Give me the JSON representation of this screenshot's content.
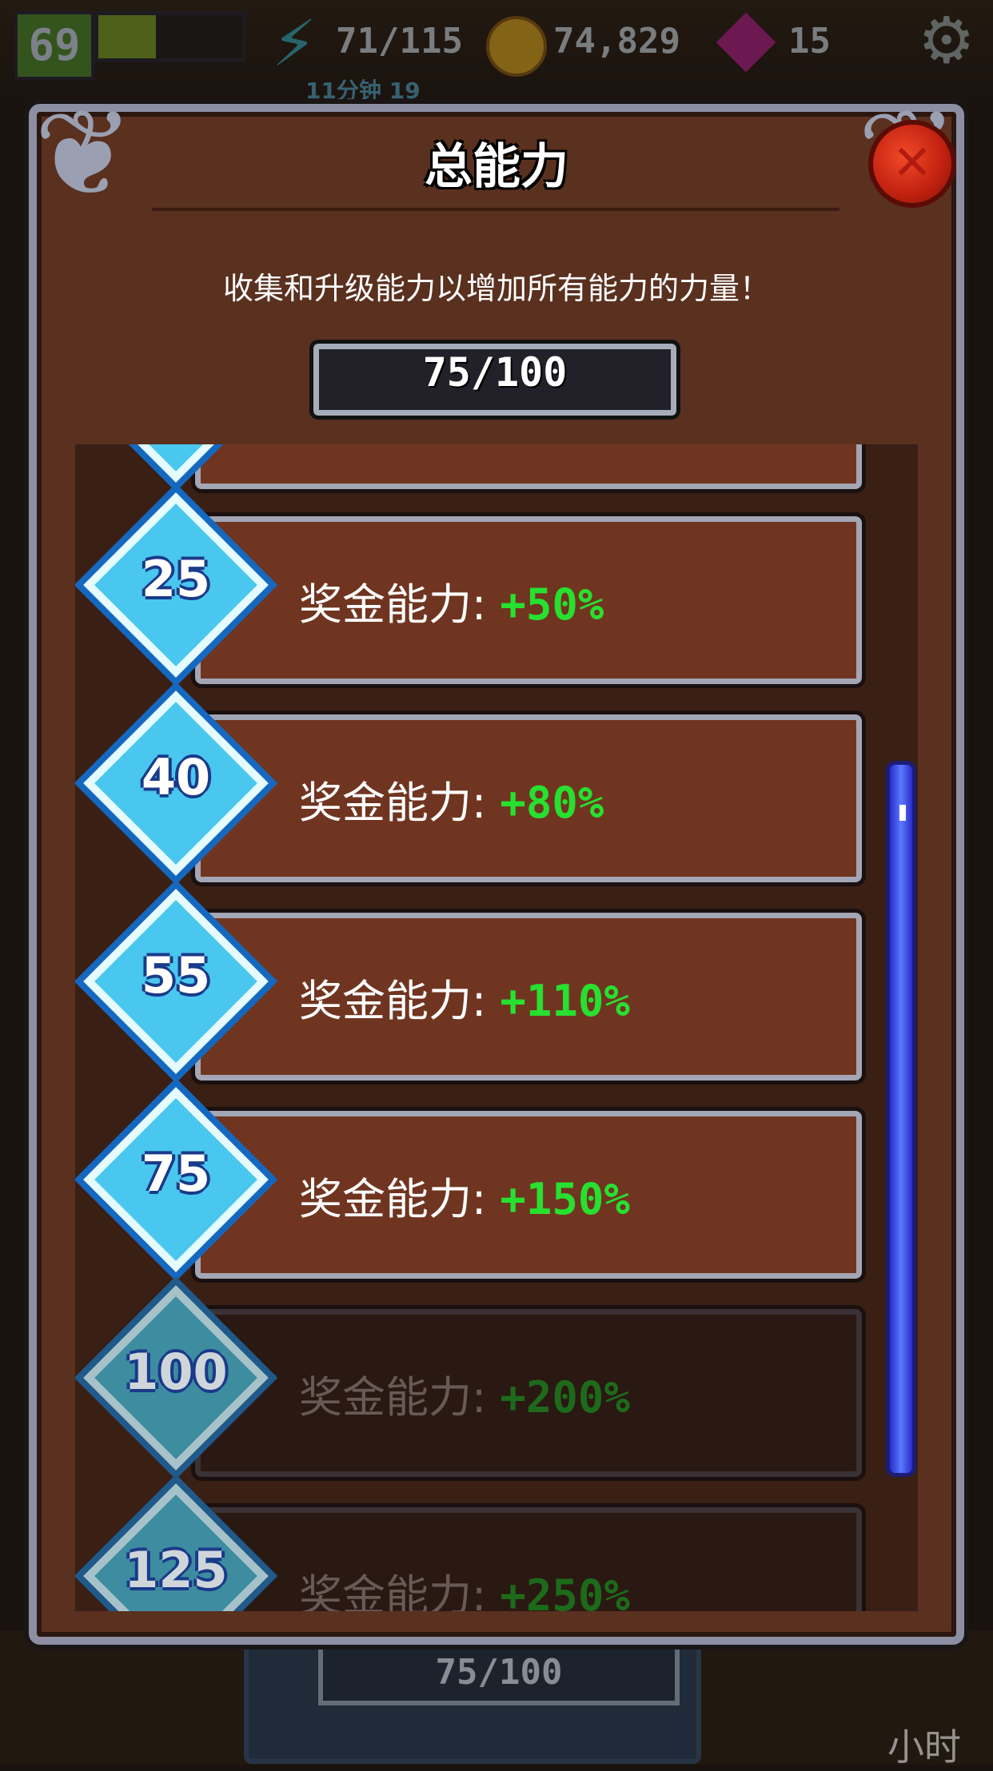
{
  "hud": {
    "level": "69",
    "energy": "71/115",
    "coins": "74,829",
    "gems": "15",
    "timer": "11分钟 19",
    "xp_fraction": 0.4
  },
  "dialog": {
    "title": "总能力",
    "subtitle": "收集和升级能力以增加所有能力的力量！",
    "progress": "75/100",
    "close_icon": "✕"
  },
  "rows": [
    {
      "tier": "",
      "label": "",
      "value": "",
      "locked": false
    },
    {
      "tier": "25",
      "label": "奖金能力:",
      "value": "+50%",
      "locked": false
    },
    {
      "tier": "40",
      "label": "奖金能力:",
      "value": "+80%",
      "locked": false
    },
    {
      "tier": "55",
      "label": "奖金能力:",
      "value": "+110%",
      "locked": false
    },
    {
      "tier": "75",
      "label": "奖金能力:",
      "value": "+150%",
      "locked": false
    },
    {
      "tier": "100",
      "label": "奖金能力:",
      "value": "+200%",
      "locked": true
    },
    {
      "tier": "125",
      "label": "奖金能力:",
      "value": "+250%",
      "locked": true
    }
  ],
  "background": {
    "counter": "75/100",
    "hours": "小时"
  },
  "colors": {
    "panel_brown": "#703520",
    "value_green": "#27e030",
    "scrollbar_blue": "#3f55ff"
  }
}
